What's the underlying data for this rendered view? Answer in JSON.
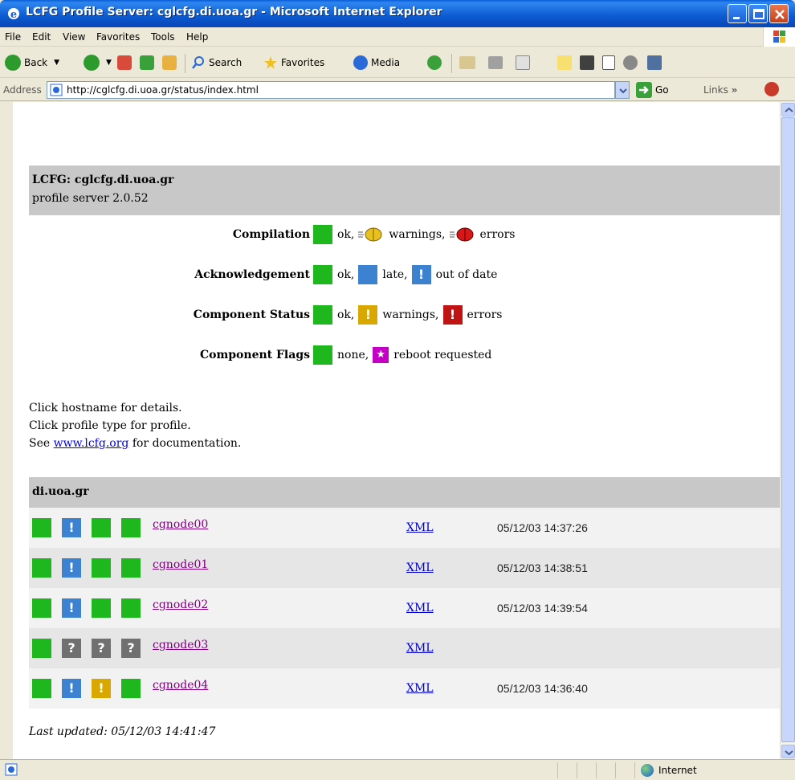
{
  "window": {
    "title": "LCFG Profile Server: cglcfg.di.uoa.gr - Microsoft Internet Explorer"
  },
  "menu": [
    "File",
    "Edit",
    "View",
    "Favorites",
    "Tools",
    "Help"
  ],
  "toolbar": {
    "back": "Back",
    "search": "Search",
    "favorites": "Favorites",
    "media": "Media"
  },
  "address": {
    "label": "Address",
    "url": "http://cglcfg.di.uoa.gr/status/index.html",
    "go": "Go",
    "links": "Links"
  },
  "page": {
    "heading": "LCFG: cglcfg.di.uoa.gr",
    "subheading": "profile server 2.0.52",
    "legend": {
      "compilation": {
        "label": "Compilation",
        "ok": "ok,",
        "warnings": "warnings,",
        "errors": "errors"
      },
      "acknowledgement": {
        "label": "Acknowledgement",
        "ok": "ok,",
        "late": "late,",
        "out_of_date": "out of date"
      },
      "component_status": {
        "label": "Component Status",
        "ok": "ok,",
        "warnings": "warnings,",
        "errors": "errors"
      },
      "component_flags": {
        "label": "Component Flags",
        "none": "none,",
        "reboot": "reboot requested"
      }
    },
    "notes": {
      "line1": "Click hostname for details.",
      "line2": "Click profile type for profile.",
      "line3_pre": "See",
      "line3_link": "www.lcfg.org",
      "line3_post": "for documentation."
    },
    "domain": "di.uoa.gr",
    "hosts": [
      {
        "name": "cgnode00",
        "type": "XML",
        "time": "05/12/03 14:37:26"
      },
      {
        "name": "cgnode01",
        "type": "XML",
        "time": "05/12/03 14:38:51"
      },
      {
        "name": "cgnode02",
        "type": "XML",
        "time": "05/12/03 14:39:54"
      },
      {
        "name": "cgnode03",
        "type": "XML",
        "time": ""
      },
      {
        "name": "cgnode04",
        "type": "XML",
        "time": "05/12/03 14:36:40"
      }
    ],
    "last_updated": "Last updated: 05/12/03 14:41:47"
  },
  "statusbar": {
    "zone": "Internet"
  },
  "colors": {
    "ok": "#1eb81e",
    "late": "#3c82d0",
    "warning": "#d8a800",
    "error": "#c01414",
    "reboot": "#c400c4",
    "unknown": "#707070",
    "header_bg": "#c8c8c8"
  }
}
